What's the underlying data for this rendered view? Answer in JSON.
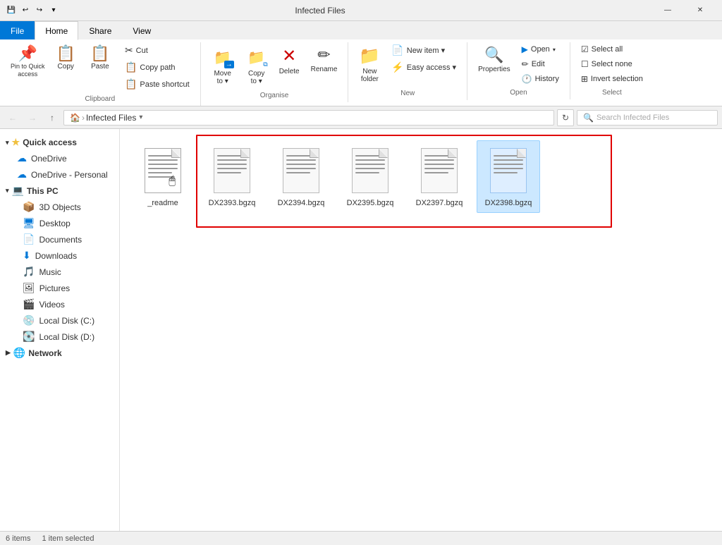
{
  "titleBar": {
    "title": "Infected Files",
    "icons": [
      "💾",
      "📌",
      "⬇"
    ],
    "windowControls": [
      "—",
      "□",
      "✕"
    ]
  },
  "ribbon": {
    "tabs": [
      {
        "label": "File",
        "active": false,
        "isFile": true
      },
      {
        "label": "Home",
        "active": true
      },
      {
        "label": "Share",
        "active": false
      },
      {
        "label": "View",
        "active": false
      }
    ],
    "groups": {
      "clipboard": {
        "label": "Clipboard",
        "pinToQuick": "Pin to Quick\naccess",
        "copy": "Copy",
        "paste": "Paste",
        "cut": "Cut",
        "copyPath": "Copy path",
        "pasteShortcut": "Paste shortcut"
      },
      "organise": {
        "label": "Organise",
        "moveTo": "Move\nto",
        "copyTo": "Copy\nto",
        "delete": "Delete",
        "rename": "Rename"
      },
      "new": {
        "label": "New",
        "newItem": "New item ▾",
        "easyAccess": "Easy access ▾",
        "newFolder": "New\nfolder"
      },
      "open": {
        "label": "Open",
        "open": "Open",
        "edit": "Edit",
        "history": "History",
        "properties": "Properties"
      },
      "select": {
        "label": "Select",
        "selectAll": "Select all",
        "selectNone": "Select none",
        "invertSelection": "Invert selection"
      }
    }
  },
  "addressBar": {
    "path": "Infected Files",
    "breadcrumb": [
      {
        "label": "🏠",
        "isHome": true
      },
      {
        "label": ">"
      },
      {
        "label": "Infected Files"
      }
    ],
    "searchPlaceholder": "Search Infected Files"
  },
  "sidebar": {
    "quickAccess": "Quick access",
    "items": [
      {
        "label": "OneDrive",
        "icon": "☁",
        "indent": 1
      },
      {
        "label": "OneDrive - Personal",
        "icon": "☁",
        "indent": 1
      },
      {
        "label": "This PC",
        "icon": "💻",
        "isSection": true,
        "indent": 1
      },
      {
        "label": "3D Objects",
        "icon": "📦",
        "indent": 2
      },
      {
        "label": "Desktop",
        "icon": "🖥",
        "indent": 2
      },
      {
        "label": "Documents",
        "icon": "📄",
        "indent": 2
      },
      {
        "label": "Downloads",
        "icon": "⬇",
        "indent": 2
      },
      {
        "label": "Music",
        "icon": "🎵",
        "indent": 2
      },
      {
        "label": "Pictures",
        "icon": "🖼",
        "indent": 2
      },
      {
        "label": "Videos",
        "icon": "🎬",
        "indent": 2
      },
      {
        "label": "Local Disk (C:)",
        "icon": "💿",
        "indent": 2
      },
      {
        "label": "Local Disk (D:)",
        "icon": "💽",
        "indent": 2
      },
      {
        "label": "Network",
        "icon": "🌐",
        "indent": 1
      }
    ]
  },
  "files": [
    {
      "name": "_readme",
      "selected": false,
      "hasCursor": true
    },
    {
      "name": "DX2393.bgzq",
      "selected": false,
      "inBox": true
    },
    {
      "name": "DX2394.bgzq",
      "selected": false,
      "inBox": true
    },
    {
      "name": "DX2395.bgzq",
      "selected": false,
      "inBox": true
    },
    {
      "name": "DX2397.bgzq",
      "selected": false,
      "inBox": true
    },
    {
      "name": "DX2398.bgzq",
      "selected": true,
      "inBox": true
    }
  ],
  "statusBar": {
    "itemCount": "6 items",
    "selectedCount": "1 item selected"
  }
}
